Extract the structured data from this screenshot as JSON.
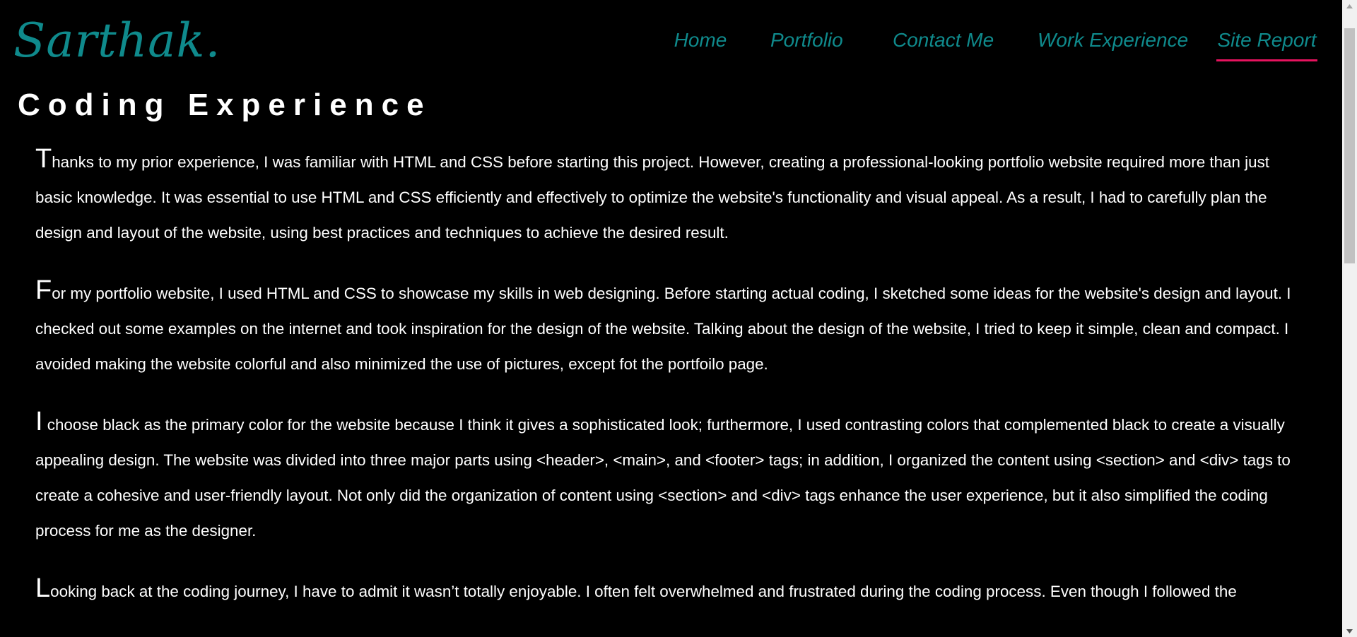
{
  "header": {
    "logo": "Sarthak."
  },
  "nav": {
    "items": [
      {
        "label": "Home"
      },
      {
        "label": "Portfolio"
      },
      {
        "label": "Contact Me"
      },
      {
        "label": "Work Experience"
      },
      {
        "label": "Site Report"
      }
    ],
    "active": "Site Report"
  },
  "main": {
    "title": "Coding Experience",
    "paragraphs": [
      {
        "first_letter": "T",
        "rest": "hanks to my prior experience, I was familiar with HTML and CSS before starting this project. However, creating a professional-looking portfolio website required more than just basic knowledge. It was essential to use HTML and CSS efficiently and effectively to optimize the website's functionality and visual appeal. As a result, I had to carefully plan the design and layout of the website, using best practices and techniques to achieve the desired result."
      },
      {
        "first_letter": "F",
        "rest": "or my portfolio website, I used HTML and CSS to showcase my skills in web designing. Before starting actual coding, I sketched some ideas for the website's design and layout. I checked out some examples on the internet and took inspiration for the design of the website. Talking about the design of the website, I tried to keep it simple, clean and compact. I avoided making the website colorful and also minimized the use of pictures, except fot the portfoilo page."
      },
      {
        "first_letter": "I",
        "rest": " choose black as the primary color for the website because I think it gives a sophisticated look; furthermore, I used contrasting colors that complemented black to create a visually appealing design. The website was divided into three major parts using <header>, <main>, and <footer> tags; in addition, I organized the content using <section> and <div> tags to create a cohesive and user-friendly layout. Not only did the organization of content using <section> and <div> tags enhance the user experience, but it also simplified the coding process for me as the designer."
      },
      {
        "first_letter": "L",
        "rest": "ooking back at the coding journey, I have to admit it wasn’t totally enjoyable. I often felt overwhelmed and frustrated during the coding process. Even though I followed the"
      }
    ]
  },
  "colors": {
    "background": "#000000",
    "accent": "#0f8a8c",
    "active_underline": "#e6135e",
    "text": "#ffffff"
  }
}
